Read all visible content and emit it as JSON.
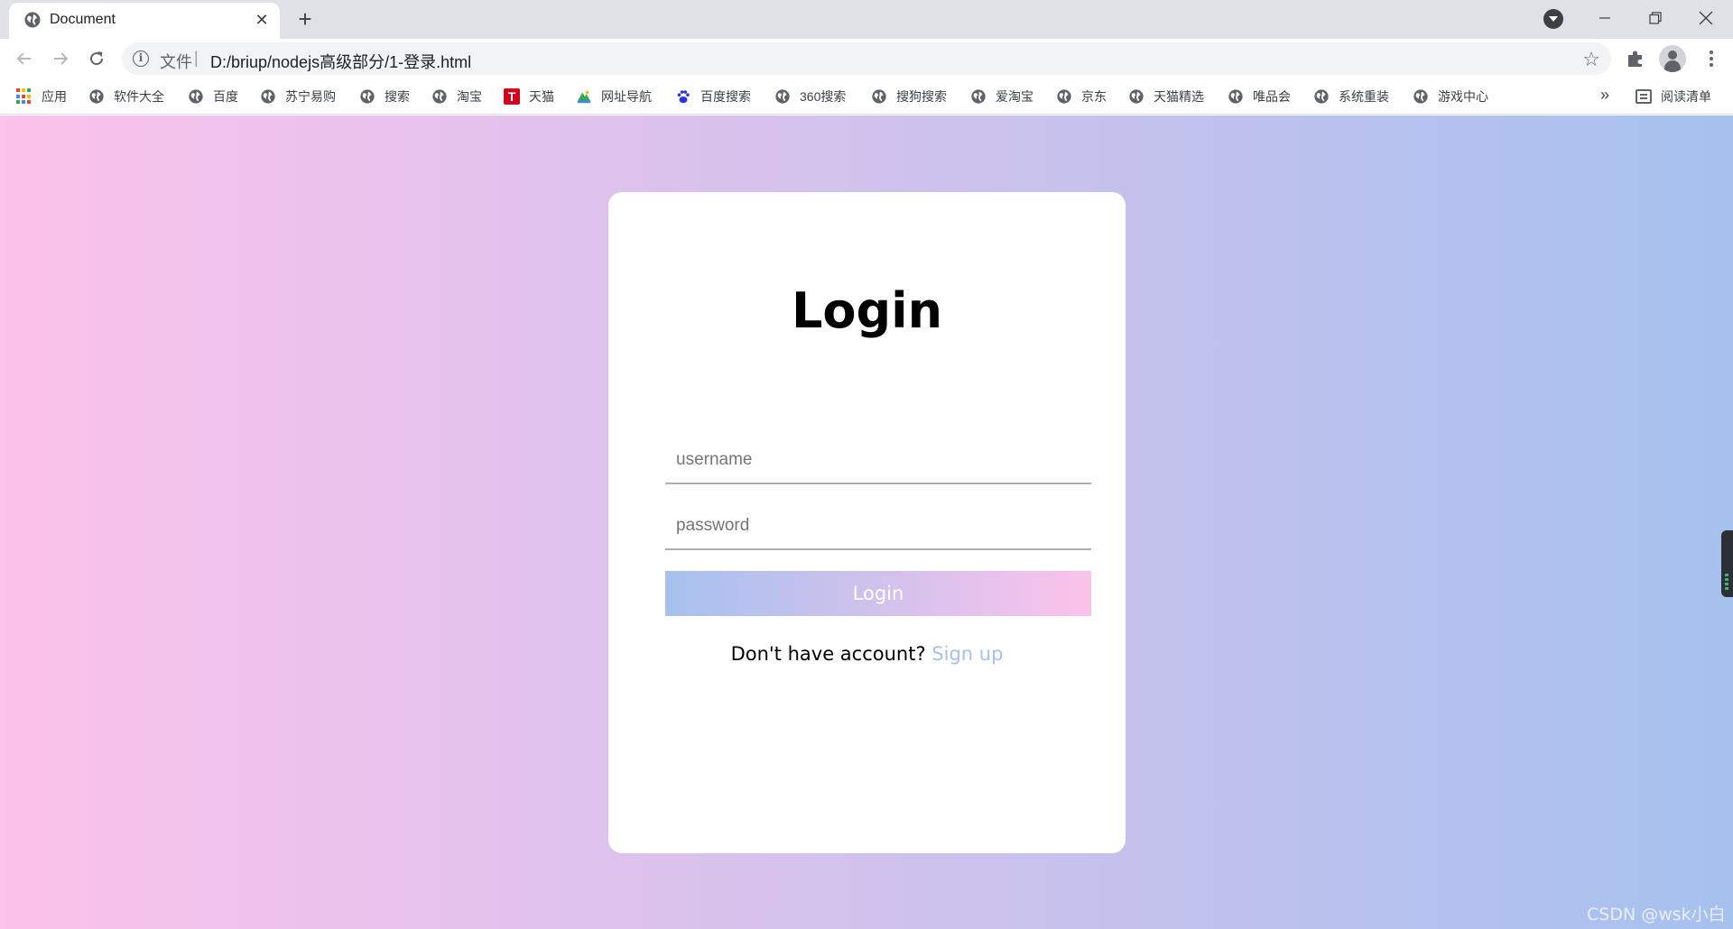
{
  "browser": {
    "tab": {
      "title": "Document"
    },
    "address": {
      "scheme_label": "文件",
      "separator": "|",
      "url": "D:/briup/nodejs高级部分/1-登录.html"
    },
    "bookmarks": [
      {
        "label": "应用",
        "icon": "apps-icon"
      },
      {
        "label": "软件大全",
        "icon": "globe-icon"
      },
      {
        "label": "百度",
        "icon": "globe-icon"
      },
      {
        "label": "苏宁易购",
        "icon": "globe-icon"
      },
      {
        "label": "搜索",
        "icon": "globe-icon"
      },
      {
        "label": "淘宝",
        "icon": "globe-icon"
      },
      {
        "label": "天猫",
        "icon": "tmall-icon"
      },
      {
        "label": "网址导航",
        "icon": "nav-site-icon"
      },
      {
        "label": "百度搜索",
        "icon": "baidu-paw-icon"
      },
      {
        "label": "360搜索",
        "icon": "globe-icon"
      },
      {
        "label": "搜狗搜索",
        "icon": "globe-icon"
      },
      {
        "label": "爱淘宝",
        "icon": "globe-icon"
      },
      {
        "label": "京东",
        "icon": "globe-icon"
      },
      {
        "label": "天猫精选",
        "icon": "globe-icon"
      },
      {
        "label": "唯品会",
        "icon": "globe-icon"
      },
      {
        "label": "系统重装",
        "icon": "globe-icon"
      },
      {
        "label": "游戏中心",
        "icon": "globe-icon"
      }
    ],
    "overflow_label": "»",
    "reading_list_label": "阅读清单"
  },
  "login": {
    "title": "Login",
    "username_placeholder": "username",
    "password_placeholder": "password",
    "button_label": "Login",
    "signup_prompt": "Don't have account?",
    "signup_link": "Sign up"
  },
  "watermark": "CSDN @wsk小白",
  "colors": {
    "gradient_start": "#fbc2eb",
    "gradient_end": "#a6c1ee",
    "link": "#a6c1ee"
  }
}
